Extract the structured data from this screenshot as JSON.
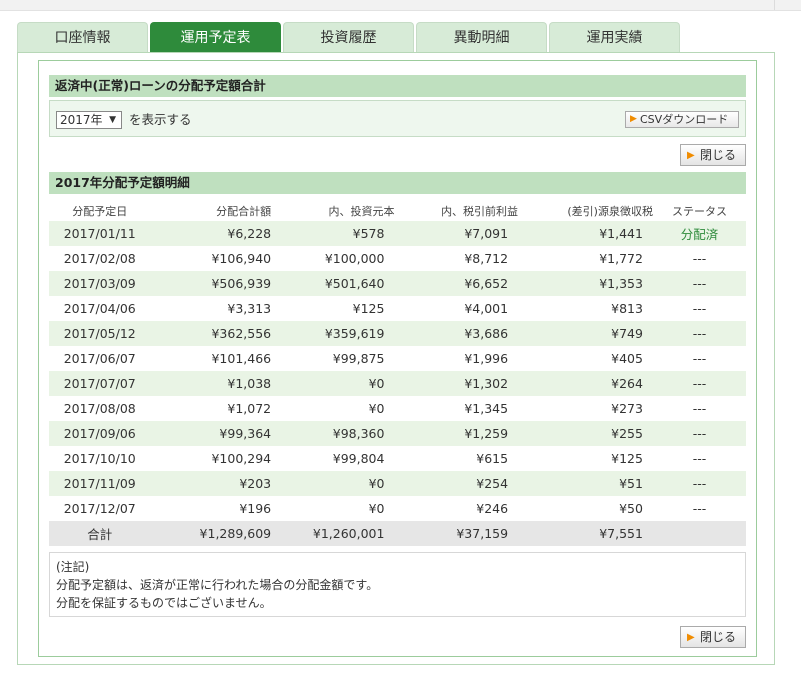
{
  "tabs": [
    {
      "label": "口座情報",
      "active": false
    },
    {
      "label": "運用予定表",
      "active": true
    },
    {
      "label": "投資履歴",
      "active": false
    },
    {
      "label": "異動明細",
      "active": false
    },
    {
      "label": "運用実績",
      "active": false
    }
  ],
  "summary": {
    "title": "返済中(正常)ローンの分配予定額合計",
    "year_selected": "2017年",
    "selector_suffix": "を表示する",
    "csv_label": "CSVダウンロード",
    "close_label": "閉じる"
  },
  "detail": {
    "title": "2017年分配予定額明細",
    "columns": [
      "分配予定日",
      "分配合計額",
      "内、投資元本",
      "内、税引前利益",
      "(差引)源泉徴収税",
      "ステータス"
    ],
    "rows": [
      [
        "2017/01/11",
        "¥6,228",
        "¥578",
        "¥7,091",
        "¥1,441",
        "分配済"
      ],
      [
        "2017/02/08",
        "¥106,940",
        "¥100,000",
        "¥8,712",
        "¥1,772",
        "---"
      ],
      [
        "2017/03/09",
        "¥506,939",
        "¥501,640",
        "¥6,652",
        "¥1,353",
        "---"
      ],
      [
        "2017/04/06",
        "¥3,313",
        "¥125",
        "¥4,001",
        "¥813",
        "---"
      ],
      [
        "2017/05/12",
        "¥362,556",
        "¥359,619",
        "¥3,686",
        "¥749",
        "---"
      ],
      [
        "2017/06/07",
        "¥101,466",
        "¥99,875",
        "¥1,996",
        "¥405",
        "---"
      ],
      [
        "2017/07/07",
        "¥1,038",
        "¥0",
        "¥1,302",
        "¥264",
        "---"
      ],
      [
        "2017/08/08",
        "¥1,072",
        "¥0",
        "¥1,345",
        "¥273",
        "---"
      ],
      [
        "2017/09/06",
        "¥99,364",
        "¥98,360",
        "¥1,259",
        "¥255",
        "---"
      ],
      [
        "2017/10/10",
        "¥100,294",
        "¥99,804",
        "¥615",
        "¥125",
        "---"
      ],
      [
        "2017/11/09",
        "¥203",
        "¥0",
        "¥254",
        "¥51",
        "---"
      ],
      [
        "2017/12/07",
        "¥196",
        "¥0",
        "¥246",
        "¥50",
        "---"
      ]
    ],
    "total": [
      "合計",
      "¥1,289,609",
      "¥1,260,001",
      "¥37,159",
      "¥7,551",
      ""
    ]
  },
  "notes": {
    "heading": "(注記)",
    "line1": "分配予定額は、返済が正常に行われた場合の分配金額です。",
    "line2": "分配を保証するものではございません。"
  },
  "colors": {
    "accent": "#2e8b3b",
    "header_bg": "#bfe0bf",
    "row_alt": "#e9f4e5"
  },
  "icons": {
    "play": "orange-triangle-play-icon",
    "dropdown": "caret-down-icon"
  }
}
